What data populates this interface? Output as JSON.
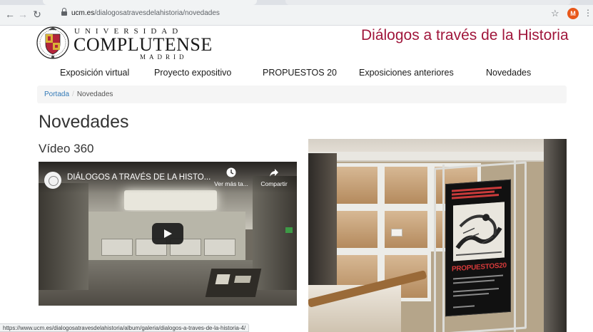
{
  "browser": {
    "url_host": "ucm.es",
    "url_path": "/dialogosatravesdelahistoria/novedades",
    "profile_initial": "M",
    "back_icon": "arrow-left-icon",
    "forward_icon": "arrow-right-icon",
    "reload_icon": "reload-icon",
    "star_icon": "star-icon",
    "menu_icon": "kebab-menu-icon",
    "status_url": "https://www.ucm.es/dialogosatravesdelahistoria/album/galeria/dialogos-a-traves-de-la-historia-4/"
  },
  "header": {
    "logo_line1": "UNIVERSIDAD",
    "logo_line2": "COMPLUTENSE",
    "logo_line3": "MADRID",
    "site_title": "Diálogos a través de la Historia",
    "accent_color": "#a0163b"
  },
  "nav": {
    "items": [
      {
        "label": "Exposición virtual"
      },
      {
        "label": "Proyecto expositivo"
      },
      {
        "label": "PROPUESTOS 20"
      },
      {
        "label": "Exposiciones anteriores"
      },
      {
        "label": "Novedades"
      }
    ]
  },
  "breadcrumb": {
    "home": "Portada",
    "separator": "/",
    "current": "Novedades"
  },
  "main": {
    "page_title": "Novedades",
    "section_title": "Vídeo 360",
    "video": {
      "title": "DIÁLOGOS A TRAVÉS DE LA HISTO...",
      "watch_later_label": "Ver más ta...",
      "share_label": "Compartir"
    },
    "poster_word": "PROPUESTOS20"
  }
}
